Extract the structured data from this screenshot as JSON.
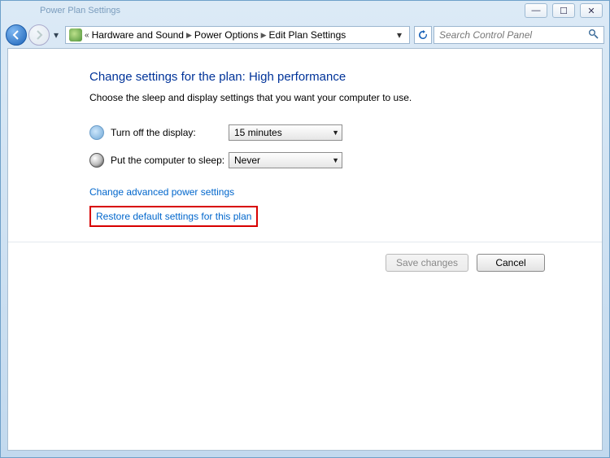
{
  "window": {
    "tab_hint": "Power Plan Settings",
    "controls": {
      "min": "—",
      "max": "☐",
      "close": "✕"
    }
  },
  "addressbar": {
    "segments": [
      "Hardware and Sound",
      "Power Options",
      "Edit Plan Settings"
    ],
    "search_placeholder": "Search Control Panel"
  },
  "page": {
    "heading": "Change settings for the plan: High performance",
    "subtext": "Choose the sleep and display settings that you want your computer to use.",
    "turn_off_display_label": "Turn off the display:",
    "turn_off_display_value": "15 minutes",
    "sleep_label": "Put the computer to sleep:",
    "sleep_value": "Never",
    "advanced_link": "Change advanced power settings",
    "restore_link": "Restore default settings for this plan",
    "save_btn": "Save changes",
    "cancel_btn": "Cancel"
  }
}
